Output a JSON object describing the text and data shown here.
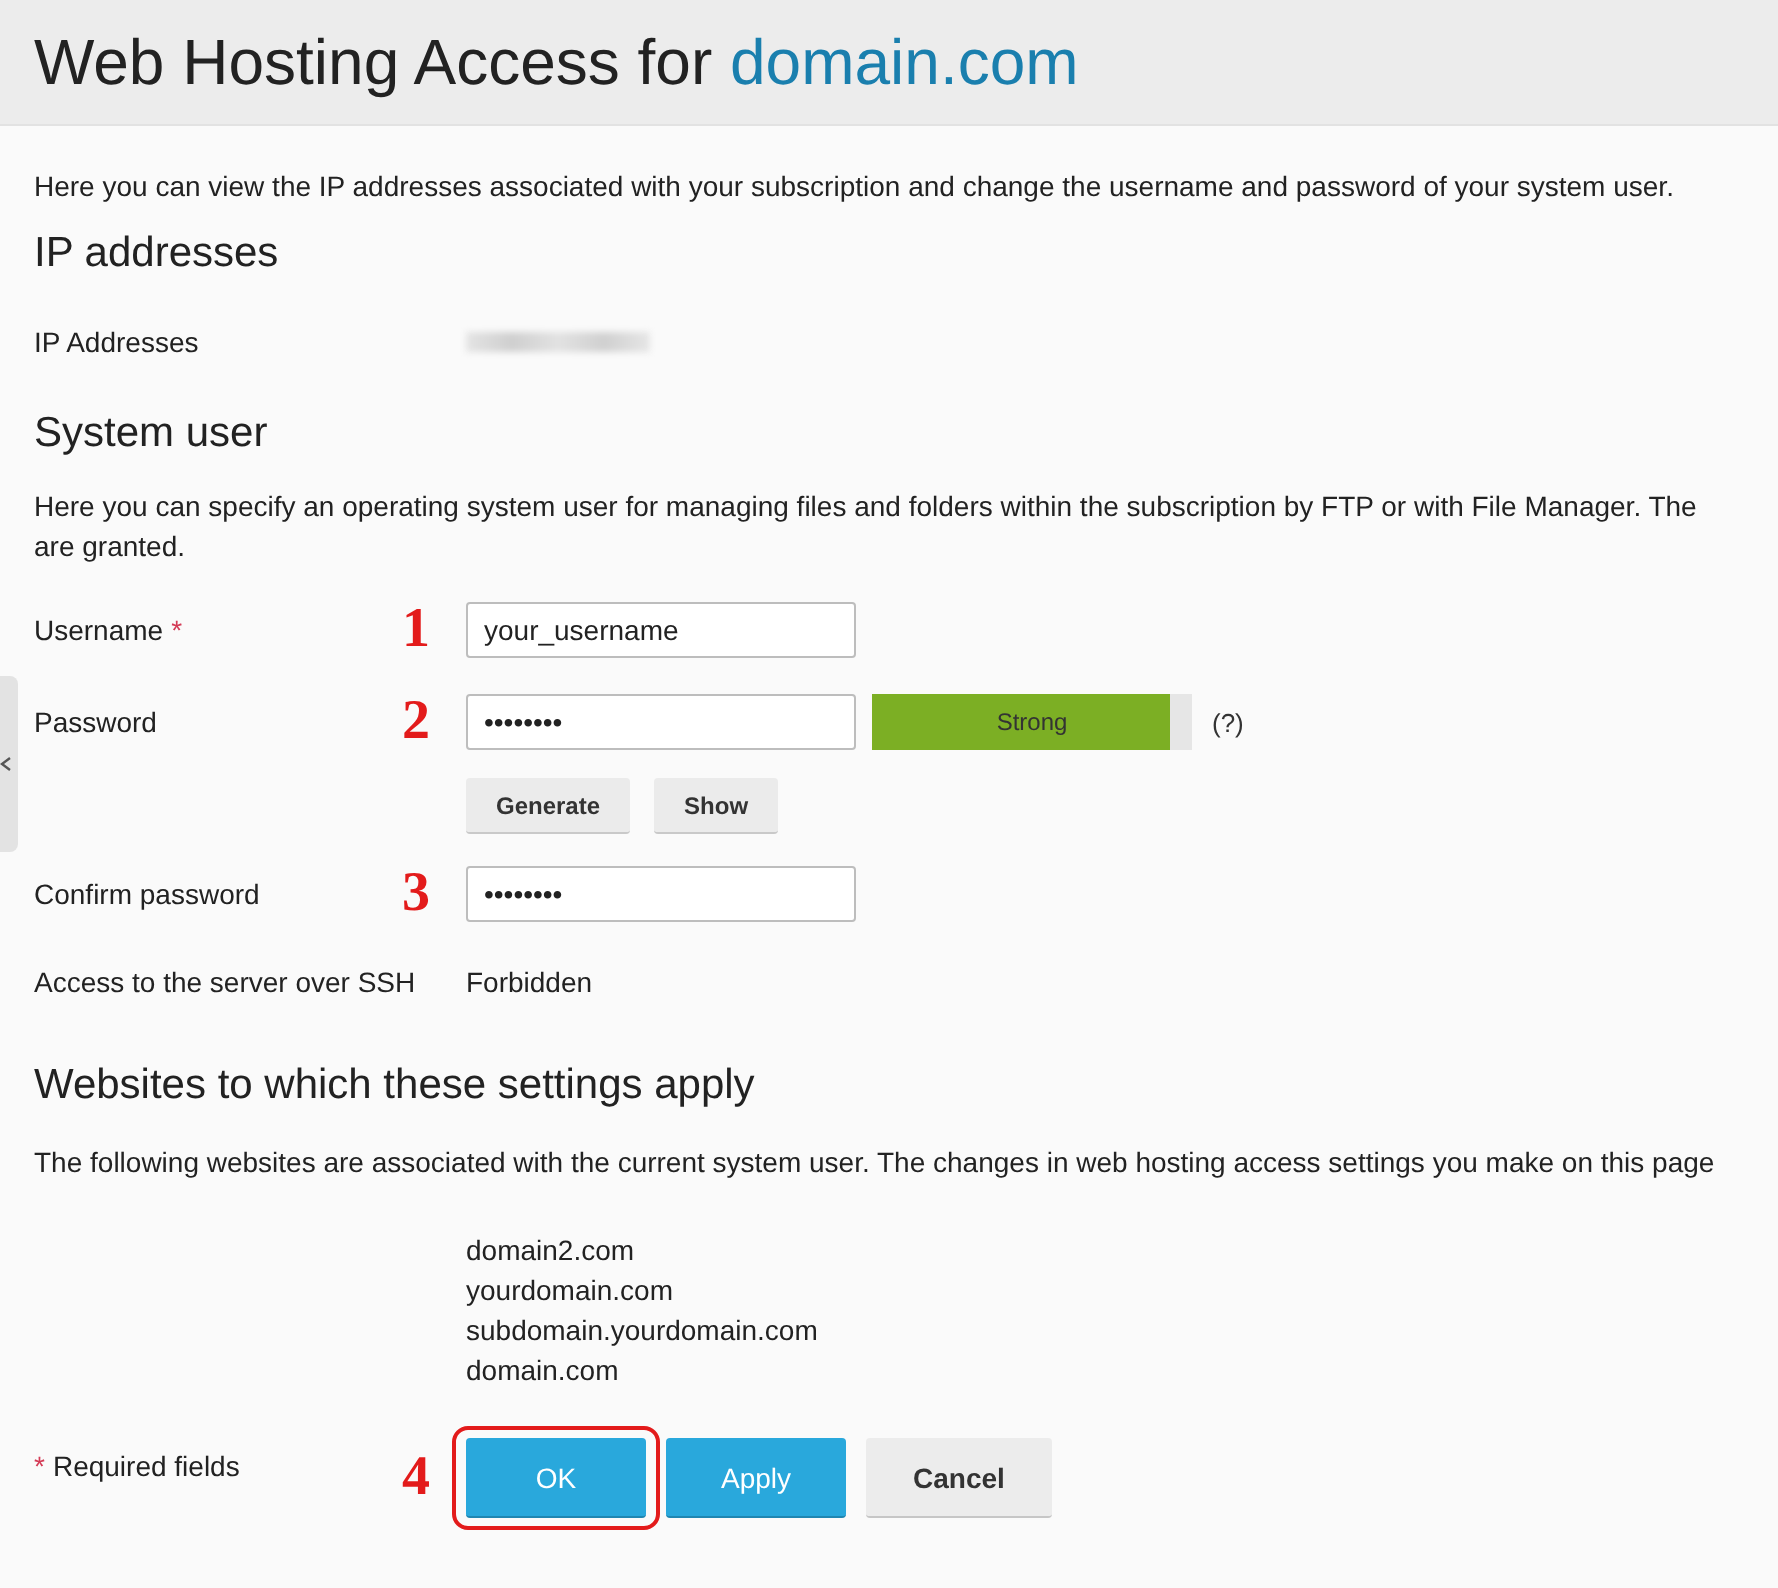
{
  "header": {
    "title": "Web Hosting Access for ",
    "title_link": "domain.com"
  },
  "intro": "Here you can view the IP addresses associated with your subscription and change the username and password of your system user.",
  "ip_section": {
    "heading": "IP addresses",
    "label": "IP Addresses"
  },
  "system_user": {
    "heading": "System user",
    "description_lines": [
      "Here you can specify an operating system user for managing files and folders within the subscription by FTP or with File Manager. The",
      "are granted."
    ],
    "fields": [
      {
        "kind": "text",
        "label": "Username",
        "required": true,
        "required_mark": "*",
        "annotation": "1",
        "value": "your_username"
      },
      {
        "kind": "password",
        "label": "Password",
        "required": false,
        "annotation": "2",
        "value": "••••••••",
        "strength": {
          "label": "Strong",
          "level": 0.93
        },
        "help": "(?)",
        "buttons": [
          "Generate",
          "Show"
        ]
      },
      {
        "kind": "text",
        "label": "Confirm password",
        "required": false,
        "annotation": "3",
        "value": "••••••••"
      },
      {
        "kind": "static",
        "label": "Access to the server over SSH",
        "required": false,
        "value": "Forbidden"
      }
    ]
  },
  "websites": {
    "heading": "Websites to which these settings apply",
    "description": "The following websites are associated with the current system user. The changes in web hosting access settings you make on this page",
    "sites": [
      "domain2.com",
      "yourdomain.com",
      "subdomain.yourdomain.com",
      "domain.com"
    ]
  },
  "footer": {
    "required_mark": "*",
    "required_note": "Required fields",
    "annotation": "4",
    "buttons": [
      {
        "label": "OK",
        "kind": "primary",
        "highlighted": true
      },
      {
        "label": "Apply",
        "kind": "primary",
        "highlighted": false
      },
      {
        "label": "Cancel",
        "kind": "secondary",
        "highlighted": false
      }
    ]
  }
}
